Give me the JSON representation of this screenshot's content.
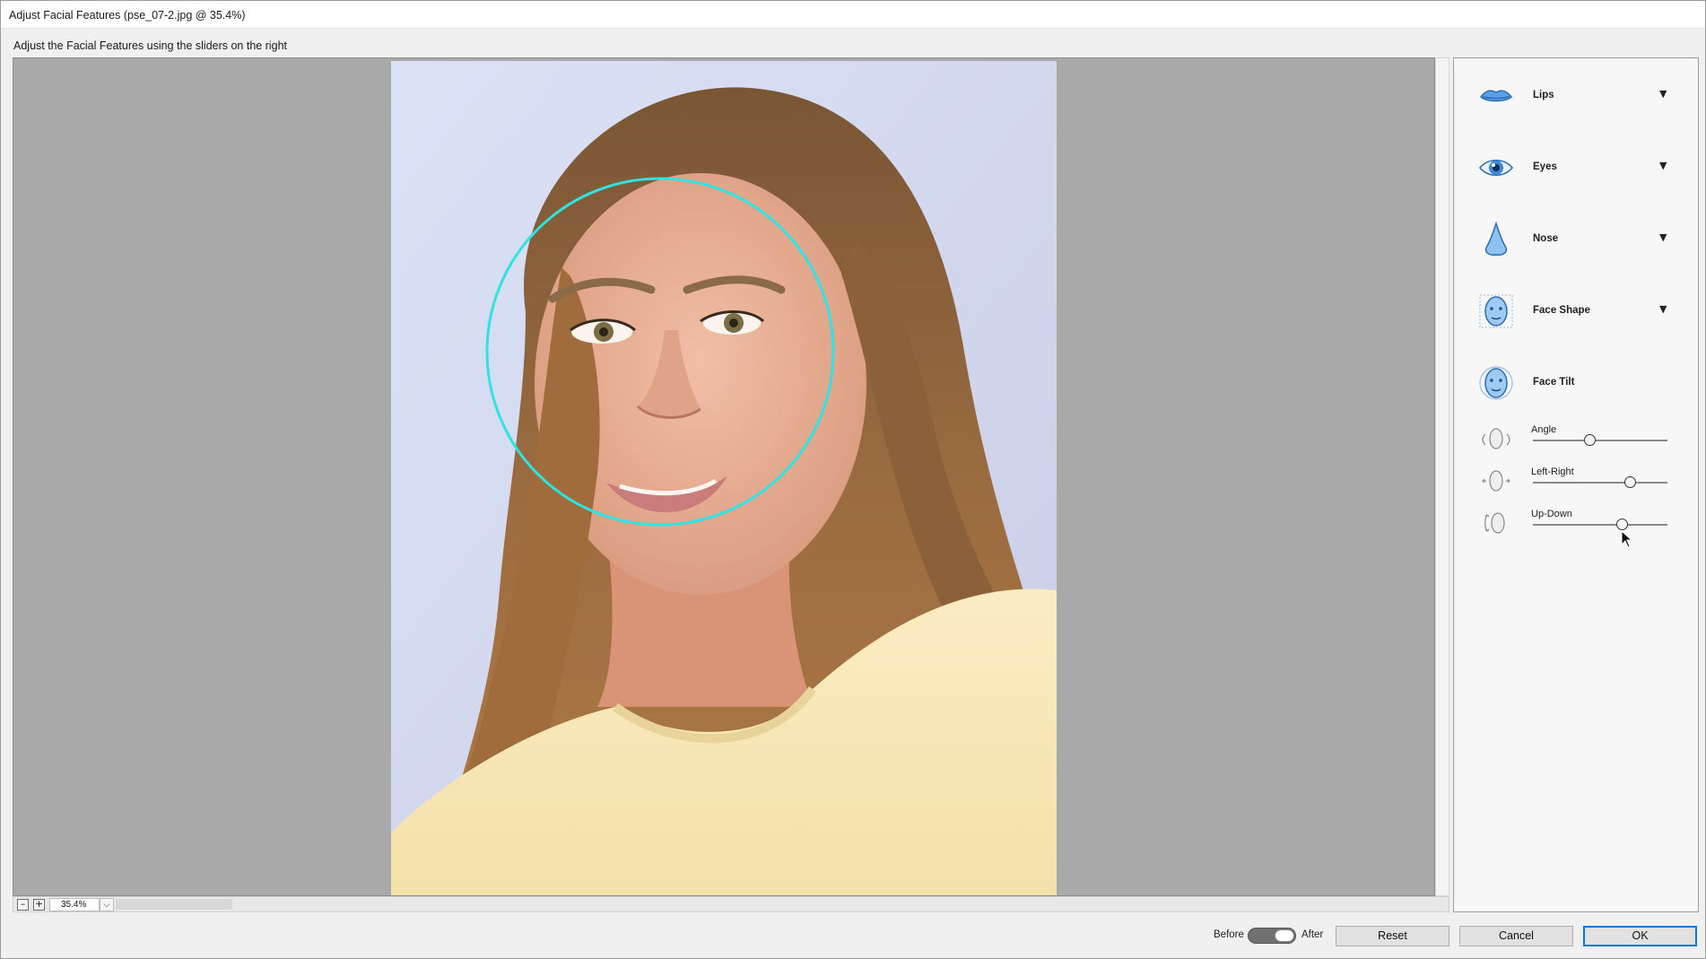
{
  "window": {
    "title": "Adjust Facial Features (pse_07-2.jpg @ 35.4%)"
  },
  "instructions": "Adjust the Facial Features using the sliders on the right",
  "canvas": {
    "face_circle_color": "#2ee3e3",
    "photo_icon": "portrait-photo"
  },
  "statusbar": {
    "zoom_out_icon": "minus-icon",
    "zoom_in_icon": "plus-icon",
    "zoom_value": "35.4%",
    "zoom_dropdown_icon": "chevron-down-icon"
  },
  "panel": {
    "features": [
      {
        "label": "Lips",
        "icon": "lips-icon",
        "arrow": "▼"
      },
      {
        "label": "Eyes",
        "icon": "eye-icon",
        "arrow": "▼"
      },
      {
        "label": "Nose",
        "icon": "nose-icon",
        "arrow": "▼"
      },
      {
        "label": "Face Shape",
        "icon": "face-shape-icon",
        "arrow": "▼"
      },
      {
        "label": "Face Tilt",
        "icon": "face-tilt-icon"
      }
    ],
    "sliders": [
      {
        "label": "Angle",
        "icon": "rotate-face-icon",
        "value_fraction": 0.42
      },
      {
        "label": "Left-Right",
        "icon": "turn-face-icon",
        "value_fraction": 0.72
      },
      {
        "label": "Up-Down",
        "icon": "tilt-face-icon",
        "value_fraction": 0.66
      }
    ]
  },
  "footer": {
    "before_label": "Before",
    "after_label": "After",
    "toggle_state": "after",
    "reset_label": "Reset",
    "cancel_label": "Cancel",
    "ok_label": "OK"
  },
  "colors": {
    "accent": "#0078d7",
    "canvas_bg": "#a9a9a9",
    "icon_blue": "#4a90d9"
  }
}
